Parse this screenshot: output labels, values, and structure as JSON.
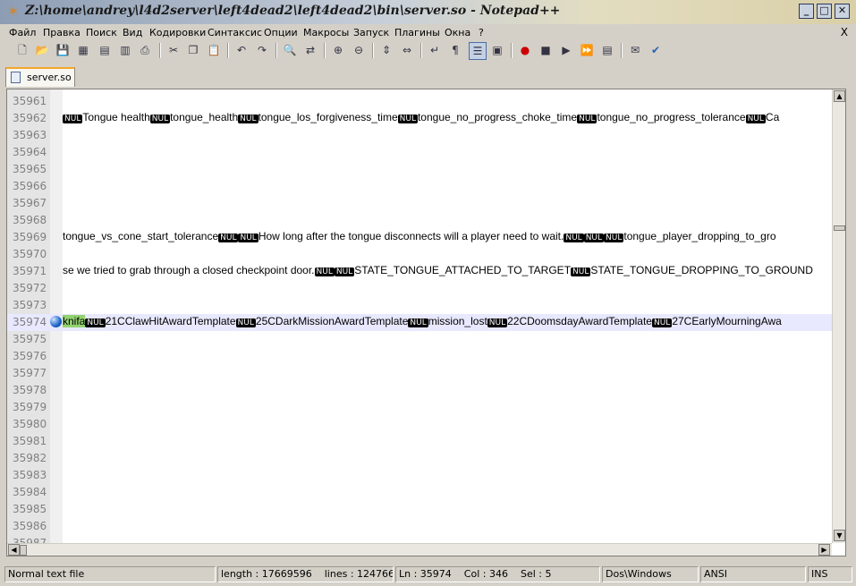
{
  "window": {
    "title": "Z:\\home\\andrey\\l4d2server\\left4dead2\\left4dead2\\bin\\server.so - Notepad++",
    "icon": "notepadpp-icon",
    "buttons": {
      "minimize": "_",
      "maximize": "□",
      "close": "✕"
    }
  },
  "menu": {
    "items": [
      {
        "label": "Файл",
        "underline": 0
      },
      {
        "label": "Правка",
        "underline": 0
      },
      {
        "label": "Поиск",
        "underline": 0
      },
      {
        "label": "Вид",
        "underline": 0
      },
      {
        "label": "Кодировки",
        "underline": 0
      },
      {
        "label": "Синтаксис",
        "underline": 0
      },
      {
        "label": "Опции",
        "underline": 0
      },
      {
        "label": "Макросы",
        "underline": 0
      },
      {
        "label": "Запуск",
        "underline": 0
      },
      {
        "label": "Плагины",
        "underline": 0
      },
      {
        "label": "Окна",
        "underline": 0
      },
      {
        "label": "?",
        "underline": 0
      }
    ],
    "close_label": "X"
  },
  "toolbar": {
    "icons": [
      "new-file-icon",
      "open-file-icon",
      "save-icon",
      "save-all-icon",
      "close-icon",
      "close-all-icon",
      "print-icon",
      "cut-icon",
      "copy-icon",
      "paste-icon",
      "undo-icon",
      "redo-icon",
      "find-icon",
      "replace-icon",
      "zoom-in-icon",
      "zoom-out-icon",
      "sync-vertical-icon",
      "sync-horizontal-icon",
      "word-wrap-icon",
      "show-all-chars-icon",
      "indent-guide-icon",
      "user-defined-lang-icon",
      "record-macro-icon",
      "stop-macro-icon",
      "play-macro-icon",
      "run-macro-multiple-icon",
      "save-macro-icon",
      "trim-icon",
      "spellcheck-icon"
    ]
  },
  "tab": {
    "label": "server.so"
  },
  "editor": {
    "lines": [
      {
        "num": "35961",
        "segments": []
      },
      {
        "num": "35962",
        "segments": [
          {
            "t": "NUL",
            "nul": true
          },
          {
            "t": "Tongue health"
          },
          {
            "t": "NUL",
            "nul": true
          },
          {
            "t": "tongue_health"
          },
          {
            "t": "NUL",
            "nul": true
          },
          {
            "t": "tongue_los_forgiveness_time"
          },
          {
            "t": "NUL",
            "nul": true
          },
          {
            "t": "tongue_no_progress_choke_time"
          },
          {
            "t": "NUL",
            "nul": true
          },
          {
            "t": "tongue_no_progress_tolerance"
          },
          {
            "t": "NUL",
            "nul": true
          },
          {
            "t": "Ca"
          }
        ]
      },
      {
        "num": "35963",
        "segments": []
      },
      {
        "num": "35964",
        "segments": []
      },
      {
        "num": "35965",
        "segments": []
      },
      {
        "num": "35966",
        "segments": []
      },
      {
        "num": "35967",
        "segments": []
      },
      {
        "num": "35968",
        "segments": []
      },
      {
        "num": "35969",
        "segments": [
          {
            "t": "tongue_vs_cone_start_tolerance"
          },
          {
            "t": "NUL",
            "nul": true
          },
          {
            "t": "NUL",
            "nul": true
          },
          {
            "t": "How long after the tongue disconnects will a player need to wait."
          },
          {
            "t": "NUL",
            "nul": true
          },
          {
            "t": "NUL",
            "nul": true
          },
          {
            "t": "NUL",
            "nul": true
          },
          {
            "t": "tongue_player_dropping_to_gro"
          }
        ]
      },
      {
        "num": "35970",
        "segments": []
      },
      {
        "num": "35971",
        "segments": [
          {
            "t": "se we tried to grab through a closed checkpoint door."
          },
          {
            "t": "NUL",
            "nul": true
          },
          {
            "t": "NUL",
            "nul": true
          },
          {
            "t": "STATE_TONGUE_ATTACHED_TO_TARGET"
          },
          {
            "t": "NUL",
            "nul": true
          },
          {
            "t": "STATE_TONGUE_DROPPING_TO_GROUND"
          }
        ]
      },
      {
        "num": "35972",
        "segments": []
      },
      {
        "num": "35973",
        "segments": []
      },
      {
        "num": "35974",
        "current": true,
        "bookmark": true,
        "segments": [
          {
            "t": "knifa",
            "sel": true
          },
          {
            "t": "NUL",
            "nul": true
          },
          {
            "t": "21CClawHitAwardTemplate"
          },
          {
            "t": "NUL",
            "nul": true
          },
          {
            "t": "25CDarkMissionAwardTemplate"
          },
          {
            "t": "NUL",
            "nul": true
          },
          {
            "t": "mission_lost"
          },
          {
            "t": "NUL",
            "nul": true
          },
          {
            "t": "22CDoomsdayAwardTemplate"
          },
          {
            "t": "NUL",
            "nul": true
          },
          {
            "t": "27CEarlyMourningAwa"
          }
        ]
      },
      {
        "num": "35975",
        "segments": []
      },
      {
        "num": "35976",
        "segments": []
      },
      {
        "num": "35977",
        "segments": []
      },
      {
        "num": "35978",
        "segments": []
      },
      {
        "num": "35979",
        "segments": []
      },
      {
        "num": "35980",
        "segments": []
      },
      {
        "num": "35981",
        "segments": []
      },
      {
        "num": "35982",
        "segments": []
      },
      {
        "num": "35983",
        "segments": []
      },
      {
        "num": "35984",
        "segments": []
      },
      {
        "num": "35985",
        "segments": []
      },
      {
        "num": "35986",
        "segments": []
      },
      {
        "num": "35987",
        "segments": []
      }
    ]
  },
  "status": {
    "file_type": "Normal text file",
    "length": "length : 17669596",
    "lines": "lines : 124766",
    "ln": "Ln : 35974",
    "col": "Col : 346",
    "sel": "Sel : 5",
    "eol": "Dos\\Windows",
    "encoding": "ANSI",
    "mode": "INS"
  }
}
